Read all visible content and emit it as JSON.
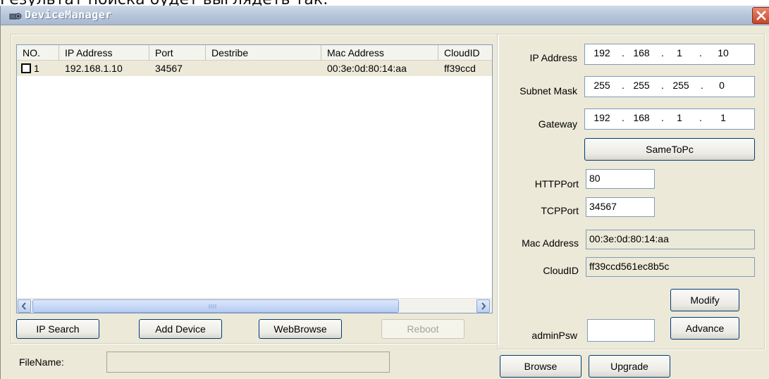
{
  "caption": "Результат поиска будет выглядеть так:",
  "window": {
    "title": "DeviceManager",
    "title_icon": "device-manager-icon",
    "close_icon": "close-icon"
  },
  "list": {
    "columns": [
      "NO.",
      "IP Address",
      "Port",
      "Destribe",
      "Mac Address",
      "CloudID"
    ],
    "rows": [
      {
        "no": "1",
        "ip": "192.168.1.10",
        "port": "34567",
        "describe": "",
        "mac": "00:3e:0d:80:14:aa",
        "cloud": "ff39ccd"
      }
    ]
  },
  "buttons": {
    "ip_search": "IP Search",
    "add_device": "Add Device",
    "web_browse": "WebBrowse",
    "reboot": "Reboot",
    "same_to_pc": "SameToPc",
    "modify": "Modify",
    "advance": "Advance",
    "browse": "Browse",
    "upgrade": "Upgrade"
  },
  "form": {
    "ip_label": "IP Address",
    "ip": [
      "192",
      "168",
      "1",
      "10"
    ],
    "subnet_label": "Subnet Mask",
    "subnet": [
      "255",
      "255",
      "255",
      "0"
    ],
    "gateway_label": "Gateway",
    "gateway": [
      "192",
      "168",
      "1",
      "1"
    ],
    "http_label": "HTTPPort",
    "http_value": "80",
    "tcp_label": "TCPPort",
    "tcp_value": "34567",
    "mac_label": "Mac Address",
    "mac_value": "00:3e:0d:80:14:aa",
    "cloud_label": "CloudID",
    "cloud_value": "ff39ccd561ec8b5c",
    "admin_label": "adminPsw",
    "admin_value": ""
  },
  "file": {
    "label": "FileName:",
    "value": ""
  },
  "colors": {
    "window_bg": "#ece9d8",
    "title_bar": "#b9c7db",
    "close_button": "#c8452a"
  }
}
